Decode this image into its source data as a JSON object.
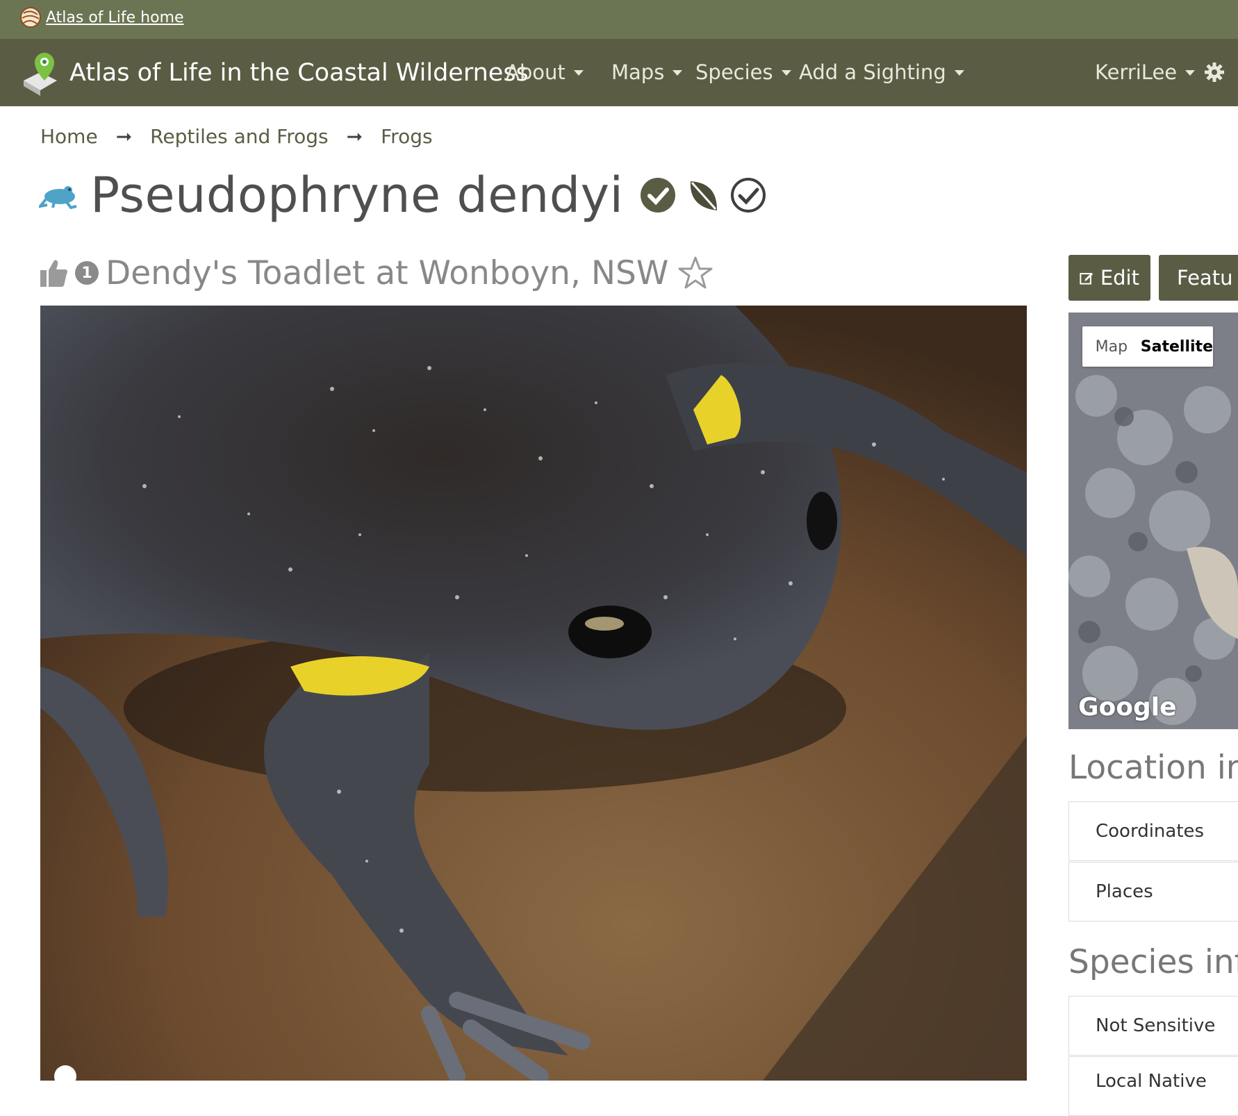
{
  "topbar": {
    "home_link": "Atlas of Life home"
  },
  "navbar": {
    "brand": "Atlas of Life in the Coastal Wilderness",
    "menu": [
      "About",
      "Maps",
      "Species",
      "Add a Sighting"
    ],
    "user": "KerriLee"
  },
  "breadcrumb": [
    "Home",
    "Reptiles and Frogs",
    "Frogs"
  ],
  "species": {
    "name": "Pseudophryne dendyi"
  },
  "sighting": {
    "likes": "1",
    "title": "Dendy's Toadlet at Wonboyn, NSW"
  },
  "actions": {
    "edit": "Edit",
    "feature": "Featu"
  },
  "map": {
    "map_option": "Map",
    "satellite_option": "Satellite",
    "attribution": "Google"
  },
  "location": {
    "heading": "Location inf",
    "items": [
      "Coordinates",
      "Places"
    ]
  },
  "species_info": {
    "heading": "Species info",
    "items": [
      "Not Sensitive",
      "Local Native"
    ]
  },
  "colors": {
    "topbar": "#6b7553",
    "navbar": "#5a5d44",
    "accent_green": "#5a5d44"
  }
}
